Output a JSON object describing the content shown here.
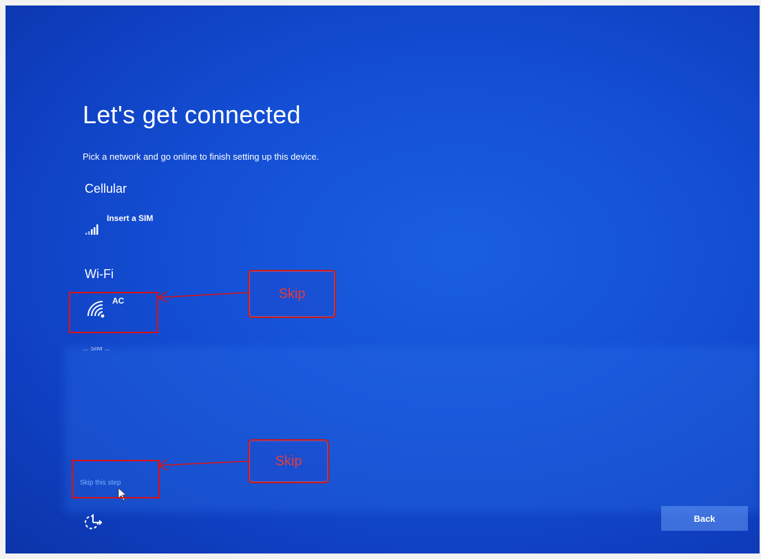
{
  "screen": {
    "title": "Let's get connected",
    "subtitle": "Pick a network and go online to finish setting up this device.",
    "cellular": {
      "label": "Cellular",
      "item_text": "Insert a SIM",
      "icon": "cellular-signal-icon"
    },
    "wifi": {
      "label": "Wi-Fi",
      "networks": [
        {
          "name": "AC",
          "icon": "wifi-secured-icon"
        }
      ],
      "partially_hidden_text": "... SIM ..."
    },
    "skip_link": "Skip this step",
    "accessibility_icon": "ease-of-access-icon",
    "back_button": "Back"
  },
  "annotations": {
    "callout_top": "Skip",
    "callout_bottom": "Skip",
    "color": "#e01010"
  },
  "colors": {
    "background": "#1450d6",
    "text": "#ffffff",
    "link": "#7fb2ff",
    "annotation": "#e01010"
  }
}
